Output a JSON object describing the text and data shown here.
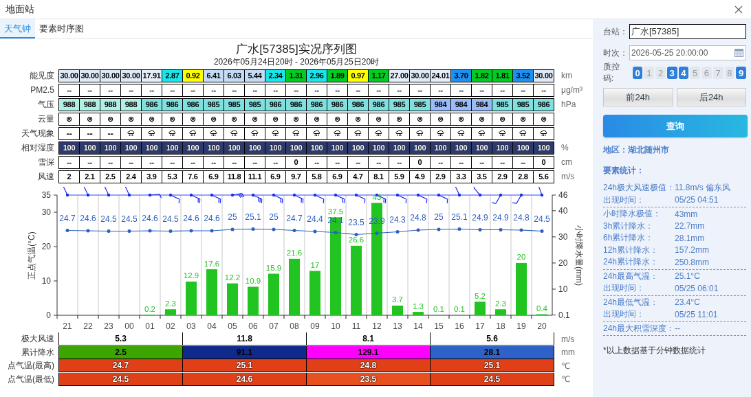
{
  "window": {
    "title": "地面站"
  },
  "tabs": [
    {
      "label": "天气钟",
      "selected": true
    },
    {
      "label": "要素时序图",
      "selected": false
    }
  ],
  "chart_title": "广水[57385]实况序列图",
  "chart_subtitle": "2026年05月24日20时 - 2026年05月25日20时",
  "obs_table": {
    "rows": [
      {
        "label": "能见度",
        "unit": "km",
        "kind": "colored",
        "cells": [
          {
            "text": "30.00",
            "color": "#dfeaf8"
          },
          {
            "text": "30.00",
            "color": "#dfeaf8"
          },
          {
            "text": "30.00",
            "color": "#dfeaf8"
          },
          {
            "text": "30.00",
            "color": "#dfeaf8"
          },
          {
            "text": "17.91",
            "color": "#e6eefa"
          },
          {
            "text": "2.87",
            "color": "#19e6ea"
          },
          {
            "text": "0.92",
            "color": "#ffff00"
          },
          {
            "text": "6.41",
            "color": "#c4dbf5"
          },
          {
            "text": "6.03",
            "color": "#c4dbf5"
          },
          {
            "text": "5.44",
            "color": "#c4dbf5"
          },
          {
            "text": "2.34",
            "color": "#19e6ea"
          },
          {
            "text": "1.31",
            "color": "#00cc22"
          },
          {
            "text": "2.96",
            "color": "#19e6ea"
          },
          {
            "text": "1.89",
            "color": "#00cc22"
          },
          {
            "text": "0.97",
            "color": "#ffff00"
          },
          {
            "text": "1.17",
            "color": "#00cc22"
          },
          {
            "text": "27.00",
            "color": "#e6eefa"
          },
          {
            "text": "30.00",
            "color": "#dfeaf8"
          },
          {
            "text": "24.01",
            "color": "#e6eefa"
          },
          {
            "text": "3.70",
            "color": "#1e90f0"
          },
          {
            "text": "1.82",
            "color": "#00cc22"
          },
          {
            "text": "1.81",
            "color": "#00cc22"
          },
          {
            "text": "3.52",
            "color": "#1e90f0"
          },
          {
            "text": "30.00",
            "color": "#dfeaf8"
          }
        ]
      },
      {
        "label": "PM2.5",
        "unit": "μg/m³",
        "kind": "plain",
        "cells": [
          "--",
          "--",
          "--",
          "--",
          "--",
          "--",
          "--",
          "--",
          "--",
          "--",
          "--",
          "--",
          "--",
          "--",
          "--",
          "--",
          "--",
          "--",
          "--",
          "--",
          "--",
          "--",
          "--",
          "--"
        ]
      },
      {
        "label": "气压",
        "unit": "hPa",
        "kind": "colored",
        "cells": [
          {
            "text": "988",
            "color": "#b2f0e6"
          },
          {
            "text": "988",
            "color": "#b2f0e6"
          },
          {
            "text": "988",
            "color": "#b2f0e6"
          },
          {
            "text": "988",
            "color": "#b2f0e6"
          },
          {
            "text": "986",
            "color": "#80e0e0"
          },
          {
            "text": "986",
            "color": "#80e0e0"
          },
          {
            "text": "986",
            "color": "#80e0e0"
          },
          {
            "text": "985",
            "color": "#80e0e0"
          },
          {
            "text": "985",
            "color": "#80e0e0"
          },
          {
            "text": "985",
            "color": "#80e0e0"
          },
          {
            "text": "986",
            "color": "#80e0e0"
          },
          {
            "text": "986",
            "color": "#80e0e0"
          },
          {
            "text": "986",
            "color": "#80e0e0"
          },
          {
            "text": "986",
            "color": "#80e0e0"
          },
          {
            "text": "986",
            "color": "#80e0e0"
          },
          {
            "text": "986",
            "color": "#80e0e0"
          },
          {
            "text": "985",
            "color": "#80e0e0"
          },
          {
            "text": "985",
            "color": "#80e0e0"
          },
          {
            "text": "984",
            "color": "#99bbf8"
          },
          {
            "text": "984",
            "color": "#99bbf8"
          },
          {
            "text": "984",
            "color": "#99bbf8"
          },
          {
            "text": "985",
            "color": "#80e0e0"
          },
          {
            "text": "985",
            "color": "#80e0e0"
          },
          {
            "text": "986",
            "color": "#80e0e0"
          }
        ]
      },
      {
        "label": "云量",
        "kind": "plain",
        "cells": [
          "⊗",
          "⊗",
          "⊗",
          "⊗",
          "⊗",
          "⊗",
          "⊗",
          "⊗",
          "⊗",
          "⊗",
          "⊗",
          "⊗",
          "⊗",
          "⊗",
          "⊗",
          "⊗",
          "⊗",
          "⊗",
          "⊗",
          "⊗",
          "⊗",
          "⊗",
          "⊗",
          "⊗"
        ]
      },
      {
        "label": "天气现象",
        "kind": "weather",
        "cells": [
          {
            "kind": "none",
            "text": "--"
          },
          {
            "kind": "none",
            "text": "--"
          },
          {
            "kind": "none",
            "text": "--"
          },
          {
            "kind": "rain"
          },
          {
            "kind": "rain"
          },
          {
            "kind": "rain"
          },
          {
            "kind": "rain"
          },
          {
            "kind": "rain"
          },
          {
            "kind": "rain"
          },
          {
            "kind": "rain"
          },
          {
            "kind": "rain"
          },
          {
            "kind": "rain"
          },
          {
            "kind": "rain"
          },
          {
            "kind": "rain"
          },
          {
            "kind": "rain"
          },
          {
            "kind": "rain"
          },
          {
            "kind": "rain"
          },
          {
            "kind": "rain"
          },
          {
            "kind": "rain"
          },
          {
            "kind": "rain"
          },
          {
            "kind": "rain"
          },
          {
            "kind": "rain"
          },
          {
            "kind": "rain"
          },
          {
            "kind": "rain"
          }
        ]
      },
      {
        "label": "相对湿度",
        "unit": "%",
        "kind": "halo",
        "cells": [
          {
            "text": "100",
            "color": "#2e3a6c"
          },
          {
            "text": "100",
            "color": "#2e3a6c"
          },
          {
            "text": "100",
            "color": "#2e3a6c"
          },
          {
            "text": "100",
            "color": "#2e3a6c"
          },
          {
            "text": "100",
            "color": "#2e3a6c"
          },
          {
            "text": "100",
            "color": "#2e3a6c"
          },
          {
            "text": "100",
            "color": "#2e3a6c"
          },
          {
            "text": "100",
            "color": "#2e3a6c"
          },
          {
            "text": "100",
            "color": "#2e3a6c"
          },
          {
            "text": "100",
            "color": "#2e3a6c"
          },
          {
            "text": "100",
            "color": "#2e3a6c"
          },
          {
            "text": "100",
            "color": "#2e3a6c"
          },
          {
            "text": "100",
            "color": "#2e3a6c"
          },
          {
            "text": "100",
            "color": "#2e3a6c"
          },
          {
            "text": "100",
            "color": "#2e3a6c"
          },
          {
            "text": "100",
            "color": "#2e3a6c"
          },
          {
            "text": "100",
            "color": "#2e3a6c"
          },
          {
            "text": "100",
            "color": "#2e3a6c"
          },
          {
            "text": "100",
            "color": "#2e3a6c"
          },
          {
            "text": "100",
            "color": "#2e3a6c"
          },
          {
            "text": "100",
            "color": "#2e3a6c"
          },
          {
            "text": "100",
            "color": "#2e3a6c"
          },
          {
            "text": "100",
            "color": "#2e3a6c"
          },
          {
            "text": "100",
            "color": "#2e3a6c"
          }
        ]
      },
      {
        "label": "雪深",
        "unit": "cm",
        "kind": "plain",
        "cells": [
          "--",
          "--",
          "--",
          "--",
          "--",
          "--",
          "--",
          "--",
          "--",
          "--",
          "--",
          "0",
          "--",
          "--",
          "--",
          "--",
          "--",
          "0",
          "--",
          "--",
          "--",
          "--",
          "--",
          "0"
        ]
      },
      {
        "label": "风速",
        "unit": "m/s",
        "kind": "plain",
        "cells": [
          "2",
          "2.1",
          "2.5",
          "2.4",
          "3.9",
          "5.3",
          "7.6",
          "6.9",
          "11.8",
          "11.1",
          "6.9",
          "9.7",
          "5.8",
          "6.9",
          "4.7",
          "8.1",
          "5.9",
          "4.9",
          "2.9",
          "3.3",
          "3.5",
          "2.9",
          "2.8",
          "5.6"
        ]
      }
    ]
  },
  "chart_data": {
    "type": "bar",
    "ylabel": "正点气温(°C)",
    "y2label": "小时降水量(mm)",
    "categories": [
      "21",
      "22",
      "23",
      "00",
      "01",
      "02",
      "03",
      "04",
      "05",
      "06",
      "07",
      "08",
      "09",
      "10",
      "11",
      "12",
      "13",
      "14",
      "15",
      "16",
      "17",
      "18",
      "19",
      "20"
    ],
    "ylim": [
      0,
      35
    ],
    "yticks": [
      0,
      10,
      20,
      30,
      35
    ],
    "y2lim": [
      0,
      46
    ],
    "y2ticks": [
      0.1,
      10,
      20,
      30,
      40,
      46
    ],
    "data_labels": true,
    "series": [
      {
        "axis": "y2",
        "color": "#22c422",
        "values": [
          null,
          null,
          null,
          null,
          0.2,
          2.3,
          12.9,
          17.6,
          12.2,
          10.9,
          15.9,
          21.6,
          17,
          37.5,
          26.6,
          43,
          3.7,
          1.3,
          0.1,
          0.1,
          5.2,
          2.3,
          20,
          0.4
        ]
      },
      {
        "type": "line",
        "marker": true,
        "color": "#2f5fc0",
        "values": [
          24.7,
          24.6,
          24.5,
          24.5,
          24.6,
          24.5,
          24.6,
          24.6,
          25,
          25.1,
          25,
          24.7,
          24.4,
          24.1,
          23.5,
          23.9,
          24.3,
          24.8,
          25,
          25.1,
          24.9,
          24.9,
          24.8,
          24.5
        ]
      }
    ]
  },
  "summary_table": {
    "rows": [
      {
        "label": "极大风速",
        "unit": "m/s",
        "kind": "plain",
        "cells": [
          {
            "text": "5.3",
            "color": "#ffffff"
          },
          {
            "text": "11.8",
            "color": "#ffffff"
          },
          {
            "text": "8.1",
            "color": "#ffffff"
          },
          {
            "text": "5.6",
            "color": "#ffffff"
          }
        ]
      },
      {
        "label": "累计降水",
        "unit": "mm",
        "kind": "plain",
        "cells": [
          {
            "text": "2.5",
            "color": "#3ca500"
          },
          {
            "text": "91.1",
            "color": "#102a8c"
          },
          {
            "text": "129.1",
            "color": "#ff00ff"
          },
          {
            "text": "28.1",
            "color": "#2f62c8"
          }
        ]
      },
      {
        "label": "点气温(最高)",
        "unit": "℃",
        "kind": "halo",
        "cells": [
          {
            "text": "24.7",
            "color": "#e04018"
          },
          {
            "text": "25.1",
            "color": "#e04018"
          },
          {
            "text": "24.8",
            "color": "#e04018"
          },
          {
            "text": "25.1",
            "color": "#e04018"
          }
        ]
      },
      {
        "label": "点气温(最低)",
        "unit": "℃",
        "kind": "halo",
        "cells": [
          {
            "text": "24.5",
            "color": "#e04018"
          },
          {
            "text": "24.6",
            "color": "#e04018"
          },
          {
            "text": "23.5",
            "color": "#e85020"
          },
          {
            "text": "24.5",
            "color": "#e04018"
          }
        ]
      }
    ]
  },
  "side": {
    "station": {
      "label": "台站：",
      "value": "广水[57385]"
    },
    "time": {
      "label": "时次：",
      "value": "2026-05-25 20:00:00"
    },
    "qc": {
      "label": "质控码:",
      "codes": [
        {
          "label": "0",
          "selected": true
        },
        {
          "label": "1",
          "selected": false
        },
        {
          "label": "2",
          "selected": false
        },
        {
          "label": "3",
          "selected": true
        },
        {
          "label": "4",
          "selected": true
        },
        {
          "label": "5",
          "selected": false
        },
        {
          "label": "6",
          "selected": false
        },
        {
          "label": "7",
          "selected": false
        },
        {
          "label": "8",
          "selected": false
        },
        {
          "label": "9",
          "selected": true
        }
      ]
    },
    "nav_buttons": [
      "前24h",
      "后24h"
    ],
    "query_button": "查询",
    "region": "地区：湖北随州市",
    "stats_title": "要素统计：",
    "stats_groups": [
      {
        "rows": [
          {
            "label": "24h极大风速极值：",
            "value": "11.8m/s 偏东风"
          },
          {
            "label": "出现时间：",
            "value": "05/25 04:51"
          }
        ]
      },
      {
        "rows": [
          {
            "label": "小时降水极值：",
            "value": "43mm"
          },
          {
            "label": "3h累计降水：",
            "value": "22.7mm"
          },
          {
            "label": "6h累计降水：",
            "value": "28.1mm"
          },
          {
            "label": "12h累计降水：",
            "value": "157.2mm"
          },
          {
            "label": "24h累计降水：",
            "value": "250.8mm"
          }
        ]
      },
      {
        "rows": [
          {
            "label": "24h最高气温：",
            "value": "25.1°C"
          },
          {
            "label": "出现时间：",
            "value": "05/25 06:01"
          }
        ]
      },
      {
        "rows": [
          {
            "label": "24h最低气温：",
            "value": "23.4°C"
          },
          {
            "label": "出现时间：",
            "value": "05/25 11:01"
          }
        ]
      },
      {
        "rows": [
          {
            "label": "24h最大积雪深度：",
            "value": "--"
          }
        ]
      }
    ],
    "footnote": "*以上数据基于分钟数据统计"
  }
}
